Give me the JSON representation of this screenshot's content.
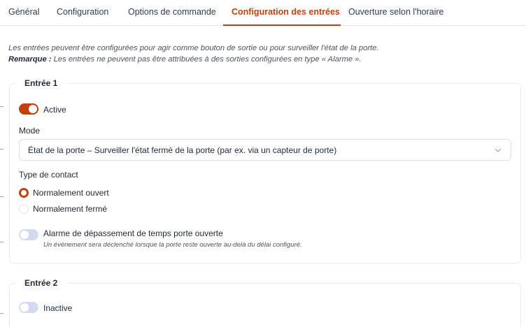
{
  "tabs": [
    {
      "label": "Général"
    },
    {
      "label": "Configuration"
    },
    {
      "label": "Options de commande"
    },
    {
      "label": "Configuration des entrées",
      "active": true
    },
    {
      "label": "Ouverture selon l'horaire"
    }
  ],
  "intro": {
    "line1": "Les entrées peuvent être configurées pour agir comme bouton de sortie ou pour surveiller l'état de la porte.",
    "note_label": "Remarque :",
    "note_text": " Les entrées ne peuvent pas être attribuées à des sorties configurées en type « Alarme »."
  },
  "inputs": [
    {
      "title": "Entrée 1",
      "status_label": "Active",
      "enabled": true,
      "mode_label": "Mode",
      "mode_value": "État de la porte – Surveiller l'état fermé de la porte (par ex. via un capteur de porte)",
      "contact_label": "Type de contact",
      "contact_options": [
        {
          "label": "Normalement ouvert",
          "selected": true
        },
        {
          "label": "Normalement fermé",
          "selected": false
        }
      ],
      "alarm_label": "Alarme de dépassement de temps porte ouverte",
      "alarm_enabled": false,
      "alarm_help": "Un événement sera déclenché lorsque la porte reste ouverte au-delà du délai configuré."
    },
    {
      "title": "Entrée 2",
      "status_label": "Inactive",
      "enabled": false
    }
  ],
  "colors": {
    "accent": "#c2410c",
    "toggle_off": "#d5daf0"
  }
}
